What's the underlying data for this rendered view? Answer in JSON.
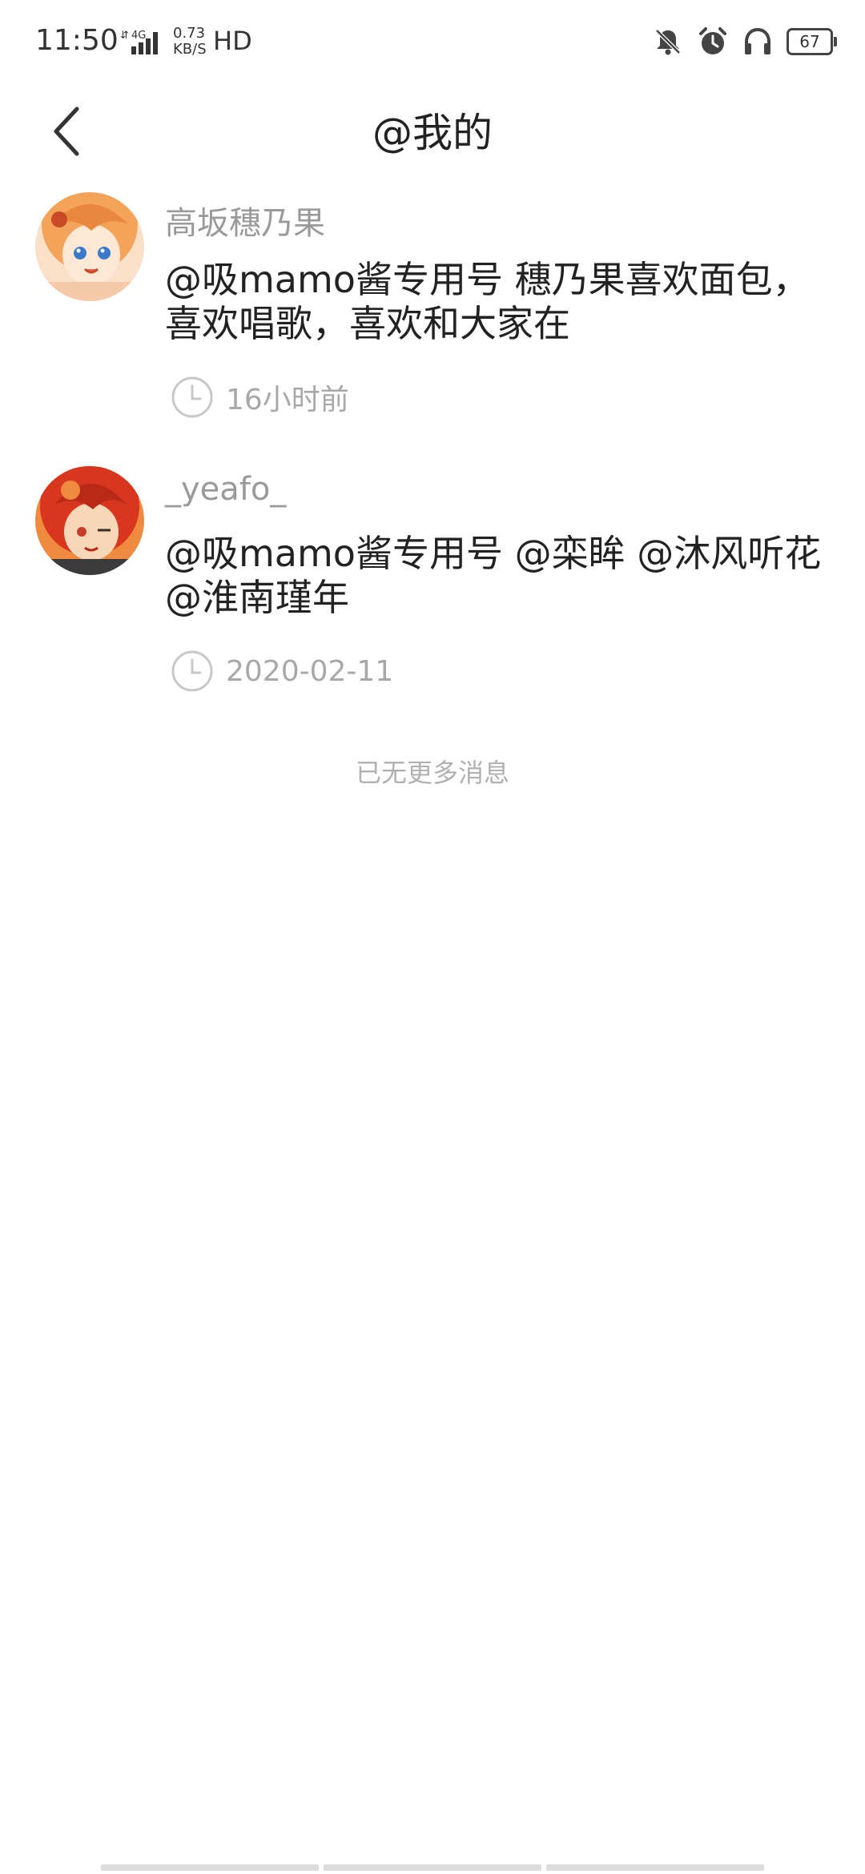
{
  "status_bar": {
    "time": "11:50",
    "network": "4G",
    "speed_value": "0.73",
    "speed_unit": "KB/S",
    "hd": "HD",
    "battery": "67",
    "icons": [
      "mute-icon",
      "alarm-icon",
      "headphones-icon",
      "battery-icon"
    ]
  },
  "header": {
    "title": "@我的",
    "back_icon": "chevron-left-icon"
  },
  "mentions": [
    {
      "name": "高坂穗乃果",
      "content": "@吸mamo酱专用号 穗乃果喜欢面包，喜欢唱歌，喜欢和大家在",
      "time": "16小时前",
      "avatar_colors": [
        "#f3a35a",
        "#c94a27",
        "#fbe0c8"
      ]
    },
    {
      "name": "_yeafo_",
      "content": " @吸mamo酱专用号 @栾眸 @沐风听花 @淮南瑾年",
      "time": "2020-02-11",
      "avatar_colors": [
        "#d8361f",
        "#f08a3e",
        "#f6d7b8"
      ]
    }
  ],
  "footer": {
    "no_more": "已无更多消息"
  }
}
